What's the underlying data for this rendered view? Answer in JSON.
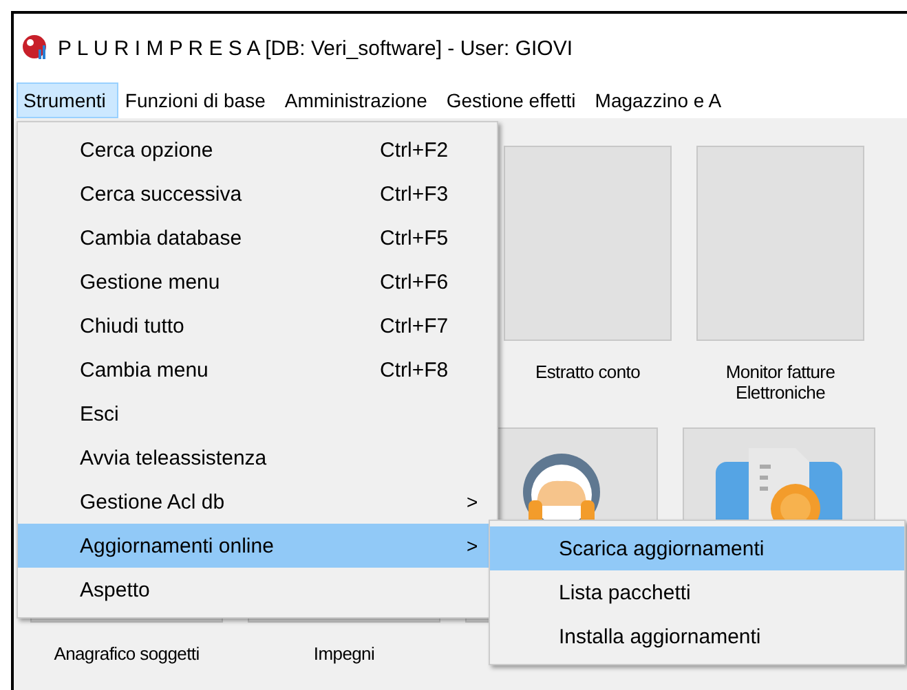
{
  "window": {
    "title": "P L U R I M P R E S A [DB: Veri_software] - User: GIOVI"
  },
  "menu_bar": [
    {
      "label": "Strumenti",
      "selected": true
    },
    {
      "label": "Funzioni di base",
      "selected": false
    },
    {
      "label": "Amministrazione",
      "selected": false
    },
    {
      "label": "Gestione effetti",
      "selected": false
    },
    {
      "label": "Magazzino e A",
      "selected": false
    }
  ],
  "tile_rows": [
    {
      "tiles": [
        {
          "label": "Estratto conto"
        },
        {
          "label": "Monitor fatture\nElettroniche"
        }
      ]
    },
    {
      "tiles": [
        {
          "label": "Anagrafico soggetti"
        },
        {
          "label": "Impegni"
        },
        {
          "kind": "headset"
        },
        {
          "kind": "document"
        }
      ]
    }
  ],
  "menu": [
    {
      "label": "Cerca opzione",
      "shortcut": "Ctrl+F2",
      "selected": false
    },
    {
      "label": "Cerca successiva",
      "shortcut": "Ctrl+F3",
      "selected": false
    },
    {
      "label": "Cambia database",
      "shortcut": "Ctrl+F5",
      "selected": false
    },
    {
      "label": "Gestione menu",
      "shortcut": "Ctrl+F6",
      "selected": false
    },
    {
      "label": "Chiudi tutto",
      "shortcut": "Ctrl+F7",
      "selected": false
    },
    {
      "label": "Cambia menu",
      "shortcut": "Ctrl+F8",
      "selected": false
    },
    {
      "label": "Esci",
      "selected": false
    },
    {
      "label": "Avvia teleassistenza",
      "selected": false
    },
    {
      "label": "Gestione Acl db",
      "arrow": ">",
      "selected": false
    },
    {
      "label": "Aggiornamenti online",
      "arrow": ">",
      "selected": true
    },
    {
      "label": "Aspetto",
      "selected": false
    }
  ],
  "submenu": [
    {
      "label": "Scarica aggiornamenti",
      "selected": true
    },
    {
      "label": "Lista pacchetti",
      "selected": false
    },
    {
      "label": "Installa aggiornamenti",
      "selected": false
    }
  ]
}
